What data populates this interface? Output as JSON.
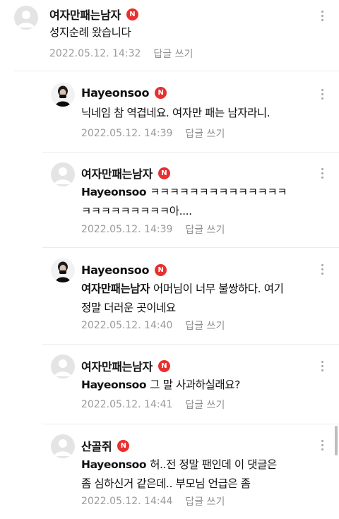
{
  "comments": [
    {
      "author": "여자만패는남자",
      "badge": "N",
      "avatar": "default-avatar",
      "mention": "",
      "text": "성지순례 왔습니다",
      "text_line2": "",
      "date": "2022.05.12. 14:32",
      "reply_label": "답글 쓰기"
    },
    {
      "author": "Hayeonsoo",
      "badge": "N",
      "avatar": "profile-photo",
      "mention": "",
      "text": "닉네임 참 역겹네요. 여자만 패는 남자라니.",
      "text_line2": "",
      "date": "2022.05.12. 14:39",
      "reply_label": "답글 쓰기"
    },
    {
      "author": "여자만패는남자",
      "badge": "N",
      "avatar": "default-avatar",
      "mention": "Hayeonsoo",
      "text": "ㅋㅋㅋㅋㅋㅋㅋㅋㅋㅋㅋㅋㅋㅋ",
      "text_line2": "ㅋㅋㅋㅋㅋㅋㅋㅋㅋ아....",
      "date": "2022.05.12. 14:39",
      "reply_label": "답글 쓰기"
    },
    {
      "author": "Hayeonsoo",
      "badge": "N",
      "avatar": "profile-photo",
      "mention": "여자만패는남자",
      "text": "어머님이 너무 불쌍하다. 여기",
      "text_line2": "정말 더러운 곳이네요",
      "date": "2022.05.12. 14:40",
      "reply_label": "답글 쓰기"
    },
    {
      "author": "여자만패는남자",
      "badge": "N",
      "avatar": "default-avatar",
      "mention": "Hayeonsoo",
      "text": "그 말 사과하실래요?",
      "text_line2": "",
      "date": "2022.05.12. 14:41",
      "reply_label": "답글 쓰기"
    },
    {
      "author": "산골쥐",
      "badge": "N",
      "avatar": "default-avatar",
      "mention": "Hayeonsoo",
      "text": "허..전 정말 팬인데 이 댓글은",
      "text_line2": "좀 심하신거 같은데.. 부모님 언급은 좀",
      "date": "2022.05.12. 14:44",
      "reply_label": "답글 쓰기"
    }
  ],
  "colors": {
    "badge": "#ea2f2f",
    "meta_text": "#9a9a9a",
    "divider": "#ececec"
  }
}
